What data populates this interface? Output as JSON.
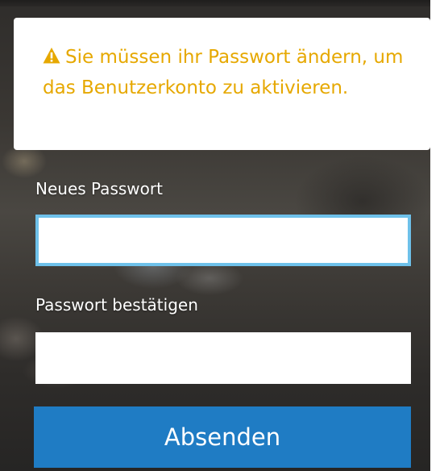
{
  "alert": {
    "icon": "warning-icon",
    "color": "#e6a800",
    "message": "Sie müssen ihr Passwort ändern, um das Benutzerkonto zu aktivieren."
  },
  "form": {
    "new_password": {
      "label": "Neues Passwort",
      "value": "",
      "placeholder": ""
    },
    "confirm_password": {
      "label": "Passwort bestätigen",
      "value": "",
      "placeholder": ""
    },
    "submit_label": "Absenden"
  },
  "colors": {
    "submit_button": "#1f7cc4",
    "focus_border": "#6ec1ea"
  }
}
